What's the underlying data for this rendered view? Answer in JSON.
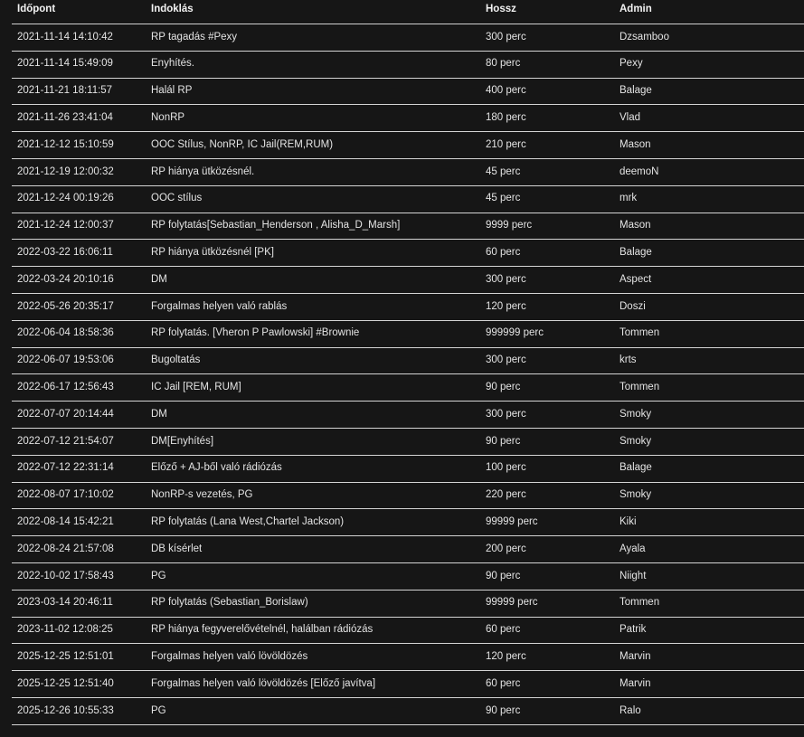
{
  "table": {
    "headers": [
      "Időpont",
      "Indoklás",
      "Hossz",
      "Admin"
    ],
    "rows": [
      [
        "2021-11-14 14:10:42",
        "RP tagadás #Pexy",
        "300 perc",
        "Dzsamboo"
      ],
      [
        "2021-11-14 15:49:09",
        "Enyhítés.",
        "80 perc",
        "Pexy"
      ],
      [
        "2021-11-21 18:11:57",
        "Halál RP",
        "400 perc",
        "Balage"
      ],
      [
        "2021-11-26 23:41:04",
        "NonRP",
        "180 perc",
        "Vlad"
      ],
      [
        "2021-12-12 15:10:59",
        "OOC Stílus, NonRP, IC Jail(REM,RUM)",
        "210 perc",
        "Mason"
      ],
      [
        "2021-12-19 12:00:32",
        "RP hiánya ütközésnél.",
        "45 perc",
        "deemoN"
      ],
      [
        "2021-12-24 00:19:26",
        "OOC stílus",
        "45 perc",
        "mrk"
      ],
      [
        "2021-12-24 12:00:37",
        "RP folytatás[Sebastian_Henderson , Alisha_D_Marsh]",
        "9999 perc",
        "Mason"
      ],
      [
        "2022-03-22 16:06:11",
        "RP hiánya ütközésnél [PK]",
        "60 perc",
        "Balage"
      ],
      [
        "2022-03-24 20:10:16",
        "DM",
        "300 perc",
        "Aspect"
      ],
      [
        "2022-05-26 20:35:17",
        "Forgalmas helyen való rablás",
        "120 perc",
        "Doszi"
      ],
      [
        "2022-06-04 18:58:36",
        "RP folytatás. [Vheron P Pawlowski] #Brownie",
        "999999 perc",
        "Tommen"
      ],
      [
        "2022-06-07 19:53:06",
        "Bugoltatás",
        "300 perc",
        "krts"
      ],
      [
        "2022-06-17 12:56:43",
        "IC Jail [REM, RUM]",
        "90 perc",
        "Tommen"
      ],
      [
        "2022-07-07 20:14:44",
        "DM",
        "300 perc",
        "Smoky"
      ],
      [
        "2022-07-12 21:54:07",
        "DM[Enyhítés]",
        "90 perc",
        "Smoky"
      ],
      [
        "2022-07-12 22:31:14",
        "Előző + AJ-ből való rádiózás",
        "100 perc",
        "Balage"
      ],
      [
        "2022-08-07 17:10:02",
        "NonRP-s vezetés, PG",
        "220 perc",
        "Smoky"
      ],
      [
        "2022-08-14 15:42:21",
        "RP folytatás (Lana West,Chartel Jackson)",
        "99999 perc",
        "Kiki"
      ],
      [
        "2022-08-24 21:57:08",
        "DB kísérlet",
        "200 perc",
        "Ayala"
      ],
      [
        "2022-10-02 17:58:43",
        "PG",
        "90 perc",
        "Niight"
      ],
      [
        "2023-03-14 20:46:11",
        "RP folytatás (Sebastian_Borislaw)",
        "99999 perc",
        "Tommen"
      ],
      [
        "2023-11-02 12:08:25",
        "RP hiánya fegyverelővételnél, halálban rádiózás",
        "60 perc",
        "Patrik"
      ],
      [
        "2025-12-25 12:51:01",
        "Forgalmas helyen való lövöldözés",
        "120 perc",
        "Marvin"
      ],
      [
        "2025-12-25 12:51:40",
        "Forgalmas helyen való lövöldözés [Előző javítva]",
        "60 perc",
        "Marvin"
      ],
      [
        "2025-12-26 10:55:33",
        "PG",
        "90 perc",
        "Ralo"
      ]
    ]
  },
  "colors": {
    "background": "#161616",
    "text": "#e4e4e4",
    "divider": "#d4d4d4"
  }
}
